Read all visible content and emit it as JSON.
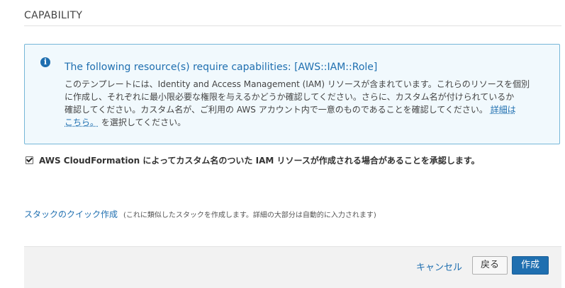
{
  "section": {
    "title": "CAPABILITY"
  },
  "info": {
    "heading": "The following resource(s) require capabilities: [AWS::IAM::Role]",
    "body_line1": "このテンプレートには、Identity and Access Management (IAM) リソースが含まれています。これらのリソースを個別",
    "body_line2": "に作成し、それぞれに最小限必要な権限を与えるかどうか確認してください。さらに、カスタム名が付けられているか",
    "body_line3": "確認してください。カスタム名が、ご利用の AWS アカウント内で一意のものであることを確認してください。",
    "details_link_1": "詳細は",
    "details_link_2": "こちら。",
    "body_tail": "を選択してください。"
  },
  "acknowledge": {
    "checked": true,
    "label": "AWS CloudFormation によってカスタム名のついた IAM リソースが作成される場合があることを承認します。"
  },
  "quick_create": {
    "link": "スタックのクイック作成",
    "note": "(これに類似したスタックを作成します。詳細の大部分は自動的に入力されます)"
  },
  "footer": {
    "cancel": "キャンセル",
    "back": "戻る",
    "create": "作成"
  },
  "colors": {
    "accent": "#1f6fb0",
    "info_border": "#76b7d8",
    "info_background": "#f1f9fd",
    "footer_background": "#f2f2f2"
  }
}
